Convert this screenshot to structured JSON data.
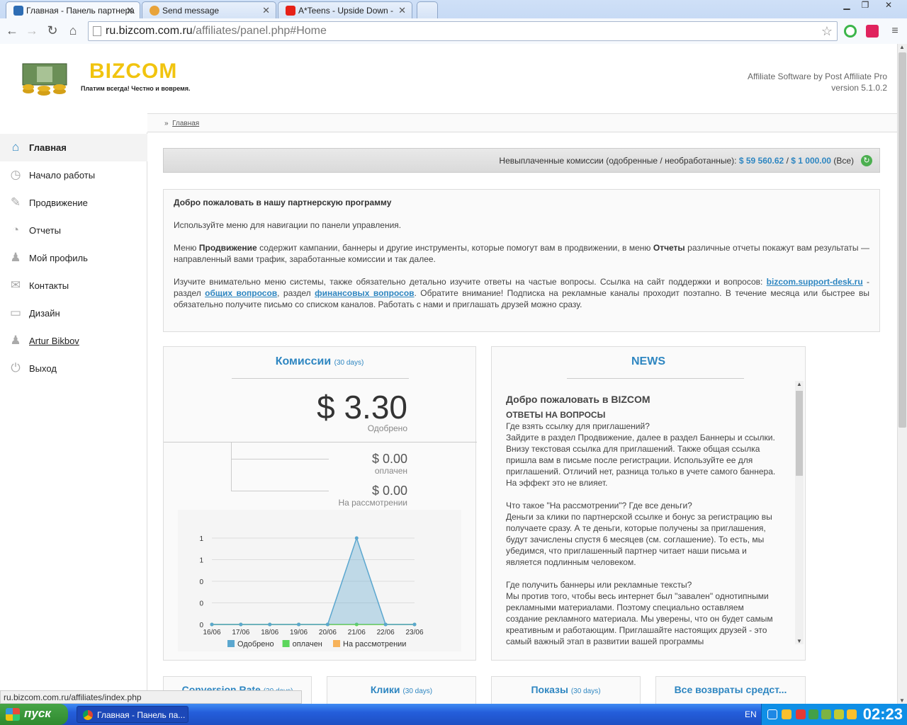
{
  "browser": {
    "tabs": [
      {
        "title": "Главная - Панель партнера",
        "active": true
      },
      {
        "title": "Send message",
        "active": false
      },
      {
        "title": "A*Teens - Upside Down -",
        "active": false
      }
    ],
    "url_host": "ru.bizcom.com.ru",
    "url_path": "/affiliates/panel.php#Home",
    "status_text": "ru.bizcom.com.ru/affiliates/index.php"
  },
  "header": {
    "logo_text": "BIZCOM",
    "slogan": "Платим всегда! Честно и вовремя.",
    "credits_line1": "Affiliate Software by Post Affiliate Pro",
    "credits_line2": "version 5.1.0.2"
  },
  "breadcrumb": {
    "sep": "»",
    "current": "Главная"
  },
  "sidebar": {
    "items": [
      {
        "label": "Главная",
        "icon": "home-icon",
        "active": true
      },
      {
        "label": "Начало работы",
        "icon": "stopwatch-icon"
      },
      {
        "label": "Продвижение",
        "icon": "megaphone-icon"
      },
      {
        "label": "Отчеты",
        "icon": "pie-chart-icon"
      },
      {
        "label": "Мой профиль",
        "icon": "user-icon"
      },
      {
        "label": "Контакты",
        "icon": "contacts-icon"
      },
      {
        "label": "Дизайн",
        "icon": "monitor-icon"
      },
      {
        "label": "Artur Bikbov",
        "icon": "user-icon"
      },
      {
        "label": "Выход",
        "icon": "power-icon"
      }
    ]
  },
  "balance": {
    "label": "Невыплаченные комиссии (одобренные / необработанные):",
    "approved": "$ 59 560.62",
    "sep": "/",
    "pending": "$ 1 000.00",
    "suffix": "(Все)"
  },
  "welcome": {
    "title": "Добро пожаловать в нашу партнерскую программу",
    "p1": "Используйте меню для навигации по панели управления.",
    "p2_a": "Меню ",
    "p2_b": "Продвижение",
    "p2_c": " содержит кампании, баннеры и другие инструменты, которые помогут вам в продвижении, в меню ",
    "p2_d": "Отчеты",
    "p2_e": " различные отчеты покажут вам результаты — направленный вами трафик, заработанные комиссии и так далее.",
    "p3_a": "Изучите внимательно меню системы, также обязательно детально изучите ответы на частые вопросы. Ссылка на сайт поддержки и вопросов: ",
    "p3_link1": "bizcom.support-desk.ru",
    "p3_b": " - раздел ",
    "p3_link2": "общих вопросов",
    "p3_c": ", раздел ",
    "p3_link3": "финансовых вопросов",
    "p3_d": ". Обратите внимание! Подписка на рекламные каналы проходит поэтапно. В течение месяца или быстрее вы обязательно получите письмо со списком каналов. Работать с нами и приглашать друзей можно сразу."
  },
  "commissions": {
    "title": "Комиссии",
    "period": "(30 days)",
    "approved_value": "$ 3.30",
    "approved_label": "Одобрено",
    "paid_value": "$ 0.00",
    "paid_label": "оплачен",
    "pending_value": "$ 0.00",
    "pending_label": "На рассмотрении"
  },
  "chart_data": {
    "type": "area",
    "categories": [
      "16/06",
      "17/06",
      "18/06",
      "19/06",
      "20/06",
      "21/06",
      "22/06",
      "23/06"
    ],
    "y_tick_labels": [
      "0",
      "0",
      "0",
      "1",
      "1"
    ],
    "ylim": [
      0,
      1
    ],
    "series": [
      {
        "name": "Одобрено",
        "color": "#5ba7cf",
        "values": [
          0,
          0,
          0,
          0,
          0,
          1,
          0,
          0
        ]
      },
      {
        "name": "оплачен",
        "color": "#5cd65c",
        "values": [
          0,
          0,
          0,
          0,
          0,
          0,
          0,
          0
        ]
      },
      {
        "name": "На рассмотрении",
        "color": "#f7b35b",
        "values": [
          0,
          0,
          0,
          0,
          0,
          0,
          0,
          0
        ]
      }
    ],
    "legend": "bottom"
  },
  "news": {
    "title": "NEWS",
    "heading": "Добро пожаловать в BIZCOM",
    "subheading": "ОТВЕТЫ НА ВОПРОСЫ",
    "q1": "Где взять ссылку для приглашений?",
    "a1": "Зайдите в раздел Продвижение, далее в раздел Баннеры и ссылки. Внизу текстовая ссылка для приглашений. Также общая ссылка пришла вам в письме после регистрации. Используйте ее для приглашений. Отличий нет, разница только в учете самого баннера. На эффект это не влияет.",
    "q2": "Что такое \"На рассмотрении\"? Где все деньги?",
    "a2": "Деньги за клики по партнерской ссылке и бонус за регистрацию вы получаете сразу. А те деньги, которые получены за приглашения, будут зачислены спустя 6 месяцев (см. соглашение). То есть, мы убедимся, что приглашенный партнер читает наши письма и является подлинным человеком.",
    "q3": "Где получить баннеры или рекламные тексты?",
    "a3": "Мы против того, чтобы весь интернет был \"завален\" однотипными рекламными материалами. Поэтому специально оставляем создание рекламного материала. Мы уверены, что он будет самым креативным и работающим. Приглашайте настоящих друзей - это самый важный этап в развитии вашей программы"
  },
  "bottom_panels": [
    {
      "title": "Conversion Rate",
      "period": "(30 days)"
    },
    {
      "title": "Клики",
      "period": "(30 days)"
    },
    {
      "title": "Показы",
      "period": "(30 days)"
    },
    {
      "title": "Все возвраты средст...",
      "period": ""
    }
  ],
  "taskbar": {
    "start_label": "пуск",
    "task_label": "Главная - Панель па...",
    "lang": "EN",
    "clock": "02:23"
  }
}
